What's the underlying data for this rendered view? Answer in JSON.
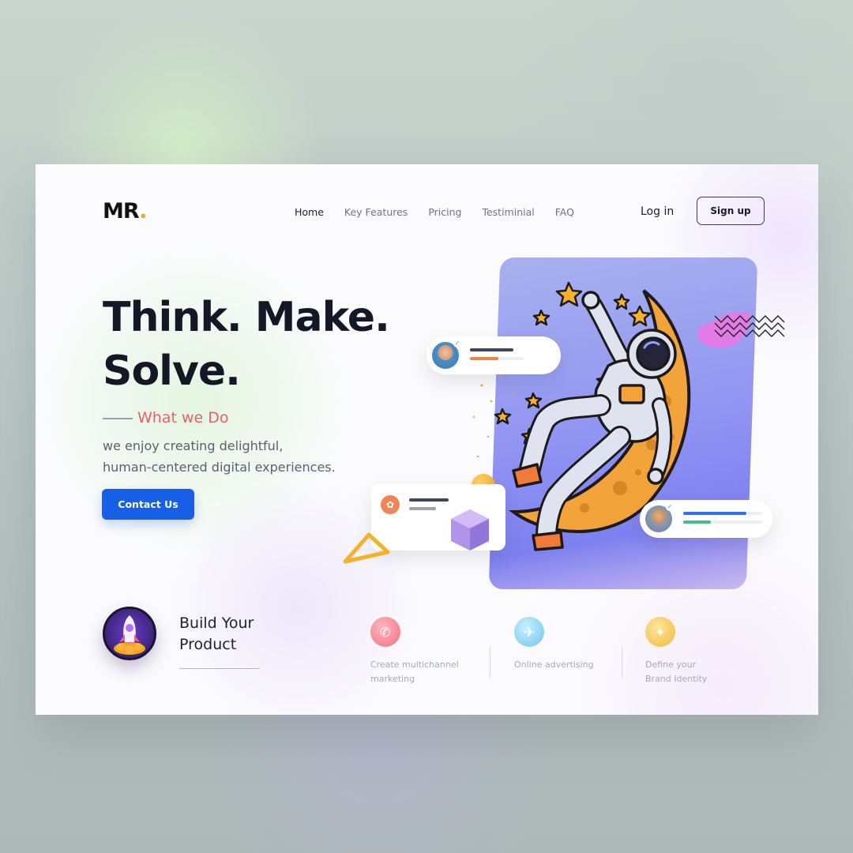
{
  "brand": {
    "logo_text": "MR",
    "logo_dot": ".",
    "accent": "#f6a609"
  },
  "nav": {
    "items": [
      {
        "label": "Home",
        "active": true
      },
      {
        "label": "Key Features",
        "active": false
      },
      {
        "label": "Pricing",
        "active": false
      },
      {
        "label": "Testiminial",
        "active": false
      },
      {
        "label": "FAQ",
        "active": false
      }
    ],
    "login_label": "Log in",
    "signup_label": "Sign up"
  },
  "hero": {
    "headline_line1": "Think. Make.",
    "headline_line2": "Solve.",
    "subtitle": "What we Do",
    "description_line1": "we enjoy creating delightful,",
    "description_line2": "human-centered digital experiences.",
    "cta_label": "Contact Us",
    "cta_color": "#1560e6",
    "subtitle_color": "#ea5f6e"
  },
  "bottom": {
    "build_line1": "Build Your",
    "build_line2": "Product",
    "features": [
      {
        "line1": "Create multichannel",
        "line2": "marketing",
        "icon": "megaphone-icon",
        "color": "#f27a8a"
      },
      {
        "line1": "Online advertising",
        "line2": "",
        "icon": "ads-icon",
        "color": "#7fd0ef"
      },
      {
        "line1": "Define your",
        "line2": "Brand Identity",
        "icon": "brand-icon",
        "color": "#f3c54a"
      }
    ]
  }
}
